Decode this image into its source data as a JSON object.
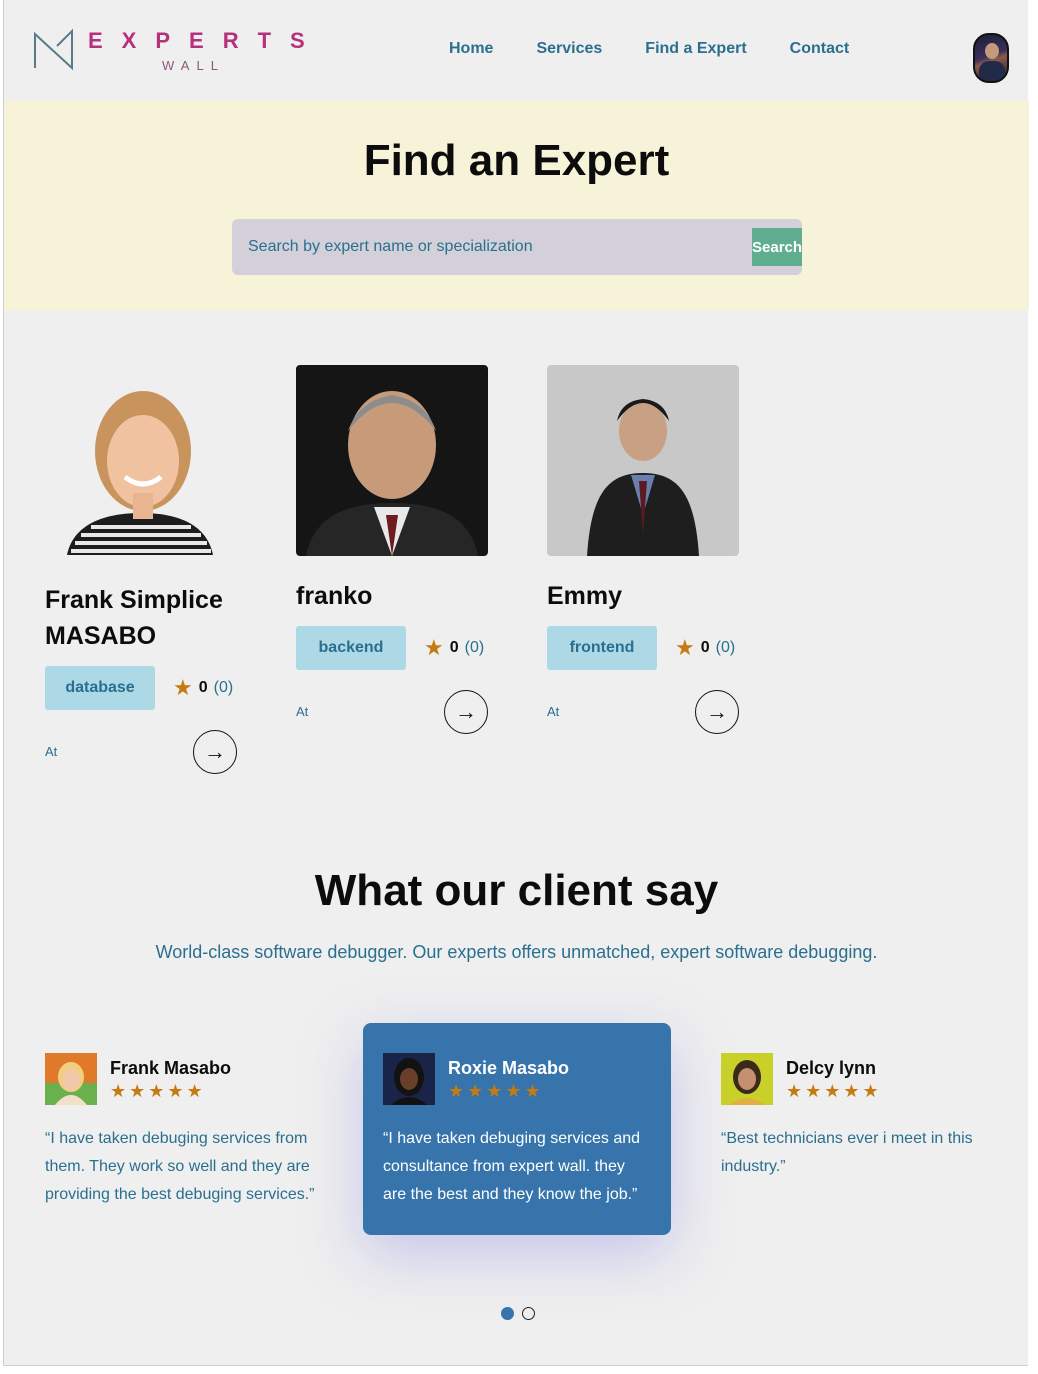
{
  "brand": {
    "top": "EXPERTS",
    "bottom": "WALL"
  },
  "nav": [
    {
      "label": "Home"
    },
    {
      "label": "Services"
    },
    {
      "label": "Find a Expert"
    },
    {
      "label": "Contact"
    }
  ],
  "hero": {
    "title": "Find an Expert",
    "search_placeholder": "Search by expert name or specialization",
    "search_button": "Search"
  },
  "experts": [
    {
      "name": "Frank Simplice MASABO",
      "tag": "database",
      "rating": "0",
      "count": "(0)",
      "at": "At"
    },
    {
      "name": "franko",
      "tag": "backend",
      "rating": "0",
      "count": "(0)",
      "at": "At"
    },
    {
      "name": "Emmy",
      "tag": "frontend",
      "rating": "0",
      "count": "(0)",
      "at": "At"
    }
  ],
  "testimonials": {
    "title": "What our client say",
    "subtitle": "World-class software debugger. Our experts offers unmatched, expert software debugging.",
    "reviews": [
      {
        "name": "Frank Masabo",
        "stars": "★★★★★",
        "text": "“I have taken debuging services from them. They work so well and they are providing the best debuging services.”"
      },
      {
        "name": "Roxie Masabo",
        "stars": "★★★★★",
        "text": "“I have taken debuging services and consultance from expert wall. they are the best and they know the job.”"
      },
      {
        "name": "Delcy lynn",
        "stars": "★★★★★",
        "text": "“Best technicians ever i meet in this industry.”"
      }
    ],
    "active_index": 1,
    "slides": 2,
    "current_slide": 1
  },
  "icons": {
    "star": "star-icon",
    "arrow": "arrow-right-icon",
    "logo": "experts-wall-logo"
  },
  "colors": {
    "accent": "#2a6f8f",
    "brand": "#b5317b",
    "hero_bg": "#f7f3d8",
    "search_btn": "#5fae90",
    "tag_bg": "#add8e6",
    "star": "#c57b13",
    "active_card": "#3674ab"
  }
}
